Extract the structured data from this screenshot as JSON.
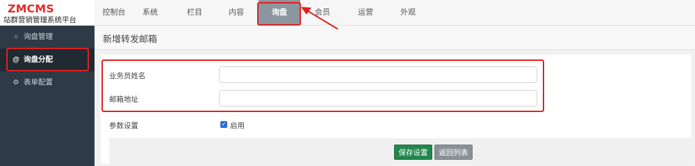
{
  "logo": {
    "title": "ZMCMS",
    "subtitle": "站群营销管理系统平台"
  },
  "nav": [
    "控制台",
    "系统",
    "栏目",
    "内容",
    "询盘",
    "会员",
    "运营",
    "外观"
  ],
  "sidebar": {
    "items": [
      {
        "label": "询盘管理",
        "icon": "chat-icon"
      },
      {
        "label": "询盘分配",
        "icon": "at-icon"
      },
      {
        "label": "表单配置",
        "icon": "gears-icon"
      }
    ]
  },
  "page": {
    "title": "新增转发邮箱",
    "form": {
      "name_label": "业务员姓名",
      "name_value": "",
      "email_label": "邮箱地址",
      "email_value": "",
      "param_label": "参数设置",
      "enable_label": "启用",
      "enable_checked": true
    },
    "buttons": {
      "save": "保存设置",
      "back": "返回列表"
    }
  },
  "colors": {
    "accent": "#e02020",
    "save": "#23864e",
    "active_nav": "#8c96a0",
    "sidebar": "#2e3b47"
  }
}
